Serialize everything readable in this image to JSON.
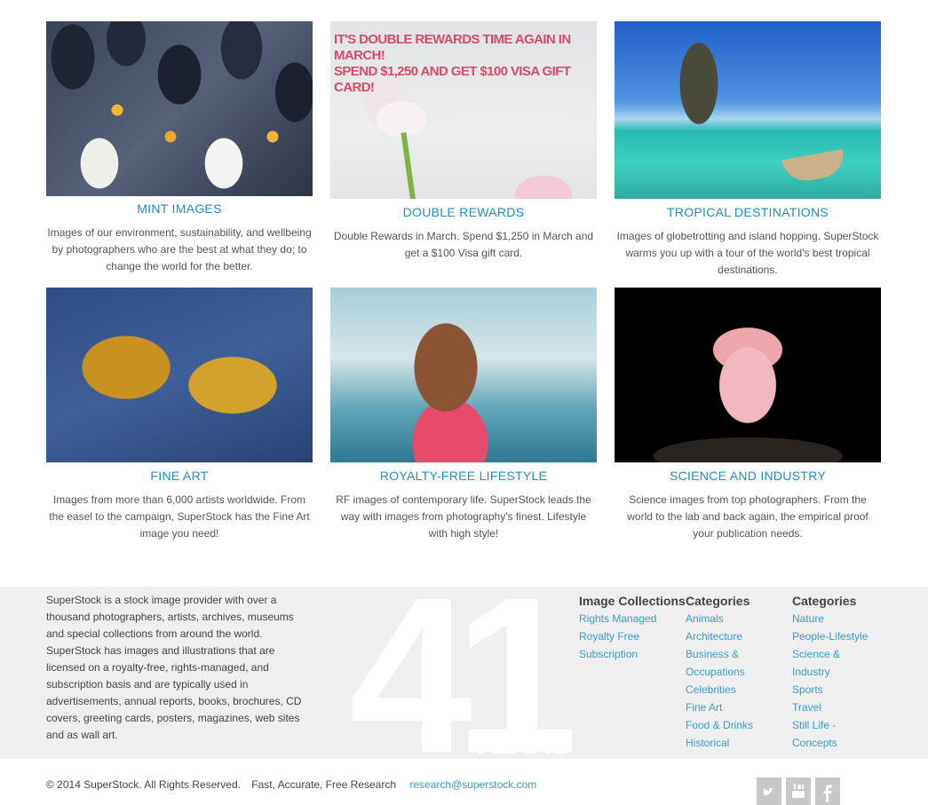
{
  "tiles": [
    {
      "title": "MINT IMAGES",
      "description": "Images of our environment, sustainability, and wellbeing by photographers who are the best at what they do; to change the world for the better."
    },
    {
      "title": "DOUBLE REWARDS",
      "description": "Double Rewards in March. Spend $1,250 in March and get a $100 Visa gift card.",
      "promo_line1": "IT'S DOUBLE REWARDS TIME AGAIN IN MARCH!",
      "promo_line2": "SPEND $1,250 AND GET $100 VISA GIFT CARD!"
    },
    {
      "title": "TROPICAL DESTINATIONS",
      "description": "Images of globetrotting and island hopping. SuperStock warms you up with a tour of the world's best tropical destinations."
    },
    {
      "title": "FINE ART",
      "description": "Images from more than 6,000 artists worldwide. From the easel to the campaign, SuperStock has the Fine Art image you need!"
    },
    {
      "title": "ROYALTY-FREE LIFESTYLE",
      "description": "RF images of contemporary life. SuperStock leads the way with images from photography's finest. Lifestyle with high style!"
    },
    {
      "title": "SCIENCE AND INDUSTRY",
      "description": "Science images from top photographers. From the world to the lab and back again, the empirical proof your publication needs."
    }
  ],
  "footer": {
    "about": "SuperStock is a stock image provider with over a thousand photographers, artists, archives, museums and special collections from around the world. SuperStock has images and illustrations that are licensed on a royalty-free, rights-managed, and subscription basis and are typically used in advertisements, annual reports, books, brochures, CD covers, greeting cards, posters, magazines, web sites and as wall art.",
    "anniversary_number": "41",
    "anniversary_word": "YEARS",
    "columns": [
      {
        "heading": "Image Collections",
        "links": [
          "Rights Managed",
          "Royalty Free",
          "Subscription"
        ]
      },
      {
        "heading": "Categories",
        "links": [
          "Animals",
          "Architecture",
          "Business & Occupations",
          "Celebrities",
          "Fine Art",
          "Food & Drinks",
          "Historical"
        ]
      },
      {
        "heading": "Categories",
        "links": [
          "Nature",
          "People-Lifestyle",
          "Science & Industry",
          "Sports",
          "Travel",
          "Still Life - Concepts"
        ]
      }
    ],
    "copyright": "© 2014 SuperStock. All Rights Reserved.",
    "tagline": "Fast, Accurate, Free Research",
    "email": "research@superstock.com",
    "social": [
      "twitter-icon",
      "youtube-icon",
      "facebook-icon"
    ]
  },
  "colors": {
    "accent": "#1a8fc9",
    "link": "#3b9bd0",
    "footer_bg": "#efefef"
  }
}
